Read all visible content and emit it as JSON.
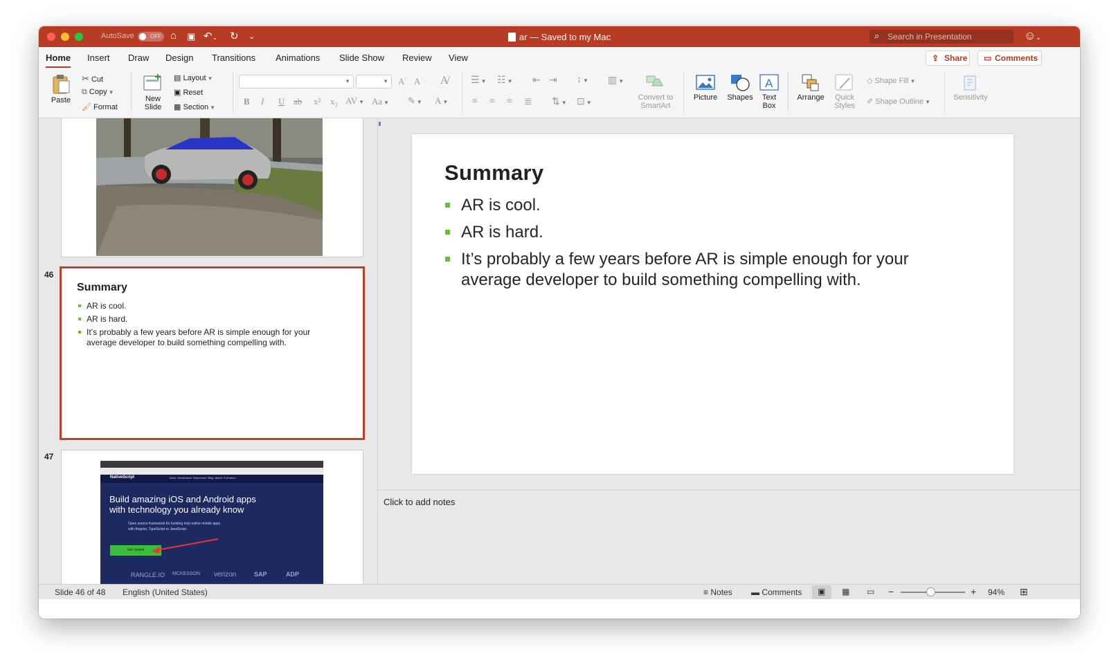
{
  "window": {
    "autosave_label": "AutoSave",
    "autosave_state": "OFF",
    "title": "ar — Saved to my Mac",
    "search_placeholder": "Search in Presentation"
  },
  "tabs": [
    "Home",
    "Insert",
    "Draw",
    "Design",
    "Transitions",
    "Animations",
    "Slide Show",
    "Review",
    "View"
  ],
  "active_tab": "Home",
  "header_buttons": {
    "share": "Share",
    "comments": "Comments"
  },
  "ribbon": {
    "paste": "Paste",
    "cut": "Cut",
    "copy": "Copy",
    "format": "Format",
    "new_slide_line1": "New",
    "new_slide_line2": "Slide",
    "layout": "Layout",
    "reset": "Reset",
    "section": "Section",
    "convert_line1": "Convert to",
    "convert_line2": "SmartArt",
    "picture": "Picture",
    "shapes": "Shapes",
    "textbox_line1": "Text",
    "textbox_line2": "Box",
    "arrange": "Arrange",
    "quick_line1": "Quick",
    "quick_line2": "Styles",
    "shape_fill": "Shape Fill",
    "shape_outline": "Shape Outline",
    "sensitivity": "Sensitivity"
  },
  "thumbnails": {
    "slide46_number": "46",
    "slide47_number": "47",
    "slide47_headline_line1": "Build amazing iOS and Android apps",
    "slide47_headline_line2": "with technology you already know",
    "slide47_sub_line1": "Open source framework for building truly native mobile apps",
    "slide47_sub_line2": "with Angular, TypeScript or JavaScript.",
    "slide47_button": "Get started",
    "slide47_brand": "NativeScript",
    "slide47_nav": "Docs  Showcases  Resources  Blog  About  Full menu",
    "slide47_logos": [
      "RANGLE.IO",
      "MCKESSON",
      "verizon",
      "SAP",
      "ADP"
    ]
  },
  "slide": {
    "title": "Summary",
    "bullets": [
      "AR is cool.",
      "AR is hard.",
      "It’s probably a few years before AR is simple enough for your average developer to build something compelling with."
    ]
  },
  "notes_placeholder": "Click to add notes",
  "status": {
    "slide_position": "Slide 46 of 48",
    "language": "English (United States)",
    "notes": "Notes",
    "comments": "Comments",
    "zoom_minus": "−",
    "zoom_plus": "+",
    "zoom": "94%",
    "zoom_fraction": 0.47
  },
  "colors": {
    "accent": "#b83b26",
    "bullet": "#5fc628",
    "selection": "#c2402a"
  }
}
